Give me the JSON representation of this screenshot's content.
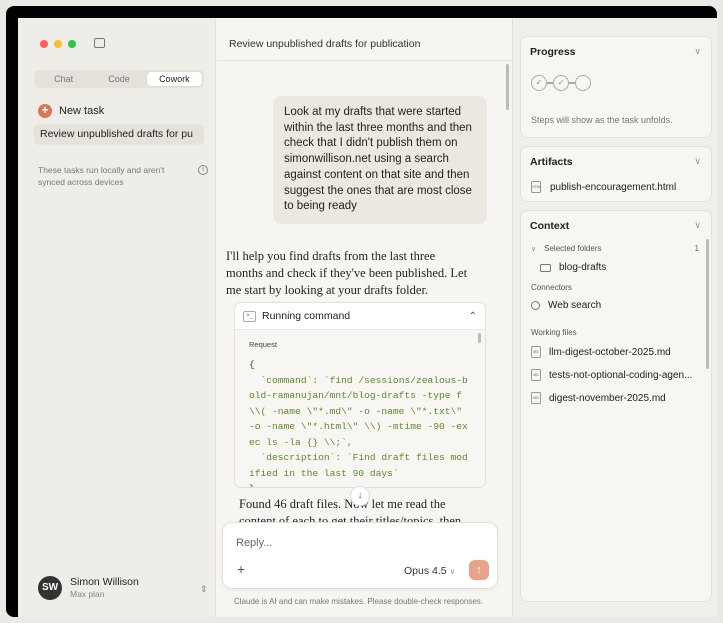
{
  "colors": {
    "close": "#ff5f57",
    "minimize": "#febc2e",
    "maximize": "#28c840",
    "accent": "#d97757"
  },
  "sidebar": {
    "modes": [
      {
        "label": "Chat"
      },
      {
        "label": "Code"
      },
      {
        "label": "Cowork"
      }
    ],
    "active_mode": "Cowork",
    "new_task_label": "New task",
    "recent_task": "Review unpublished drafts for pu",
    "local_note": "These tasks run locally and aren't synced across devices",
    "user": {
      "initials": "SW",
      "name": "Simon Willison",
      "plan": "Max plan"
    }
  },
  "main": {
    "title": "Review unpublished drafts for publication",
    "user_message": "Look at my drafts that were started within the last three months and then check that I didn't publish them on simonwillison.net using a search against content on that site and then suggest the ones that are most close to being ready",
    "assistant_reply": "I'll help you find drafts from the last three months and check if they've been published. Let me start by looking at your drafts folder.",
    "command": {
      "status": "Running command",
      "request_label": "Request",
      "code_open": "{",
      "code_body": "  `command`: `find /sessions/zealous-bold-ramanujan/mnt/blog-drafts -type f \\\\( -name \\\"*.md\\\" -o -name \\\"*.txt\\\" -o -name \\\"*.html\\\" \\\\) -mtime -90 -exec ls -la {} \\\\;`,\n  `description`: `Find draft files modified in the last 90 days`",
      "code_close": "}"
    },
    "followup": "Found 46 draft files. Now let me read the content of each to get their titles/topics, then",
    "composer": {
      "placeholder": "Reply...",
      "model": "Opus 4.5"
    },
    "disclaimer": "Claude is AI and can make mistakes. Please double-check responses."
  },
  "right": {
    "progress": {
      "title": "Progress",
      "hint": "Steps will show as the task unfolds."
    },
    "artifacts": {
      "title": "Artifacts",
      "items": [
        {
          "name": "publish-encouragement.html"
        }
      ]
    },
    "context": {
      "title": "Context",
      "selected_label": "Selected folders",
      "selected_count": "1",
      "folder": "blog-drafts",
      "connectors_label": "Connectors",
      "connector": "Web search",
      "working_label": "Working files",
      "files": [
        "llm-digest-october-2025.md",
        "tests-not-optional-coding-agen...",
        "digest-november-2025.md"
      ]
    }
  }
}
